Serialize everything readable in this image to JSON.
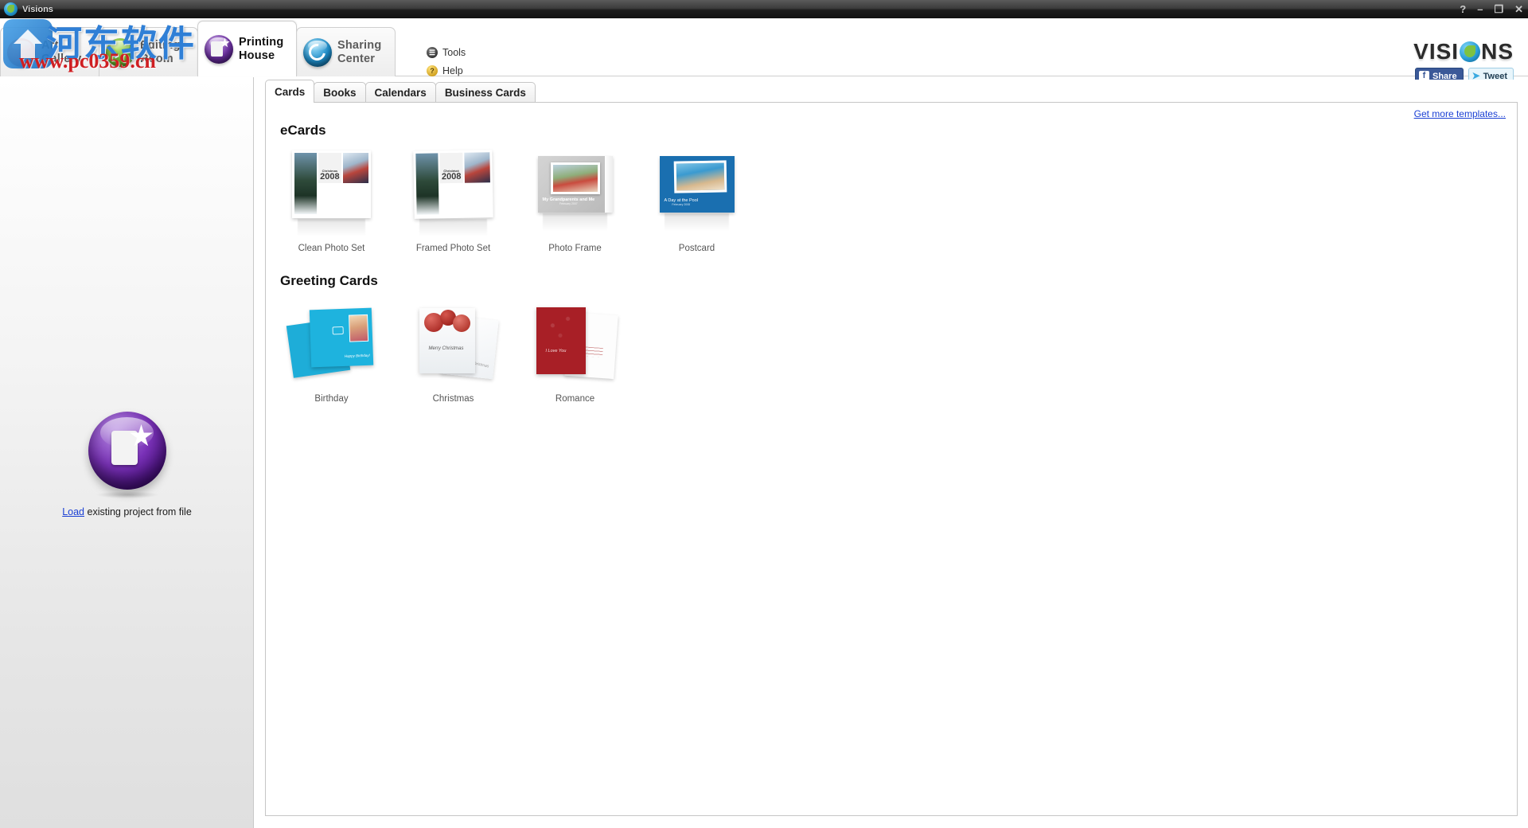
{
  "window": {
    "title": "Visions",
    "app_icon": "visions-swirl-icon",
    "controls": [
      {
        "name": "help",
        "glyph": "?"
      },
      {
        "name": "minimize",
        "glyph": "–"
      },
      {
        "name": "restore",
        "glyph": "❐"
      },
      {
        "name": "close",
        "glyph": "✕"
      }
    ]
  },
  "header": {
    "nav_tabs": [
      {
        "label": "Art\nGallery",
        "orb": "orb-art",
        "active": false
      },
      {
        "label": "Editing\nRoom",
        "orb": "orb-edit",
        "active": false
      },
      {
        "label": "Printing\nHouse",
        "orb": "orb-print",
        "active": true
      },
      {
        "label": "Sharing\nCenter",
        "orb": "orb-share",
        "active": false
      }
    ],
    "menu": [
      {
        "label": "Tools",
        "icon": "tools-icon",
        "glyph": "☰"
      },
      {
        "label": "Help",
        "icon": "help-icon",
        "glyph": "?"
      }
    ],
    "brand": {
      "part1": "VISI",
      "part2": "NS",
      "facebook_label": "Share",
      "facebook_glyph": "f",
      "twitter_label": "Tweet",
      "twitter_glyph": "➤"
    }
  },
  "watermark": {
    "chinese": "河东软件园",
    "url": "www.pc0359.cn"
  },
  "sidebar": {
    "load_link": "Load",
    "load_text": " existing project from file"
  },
  "content": {
    "tabs": [
      {
        "label": "Cards",
        "active": true
      },
      {
        "label": "Books",
        "active": false
      },
      {
        "label": "Calendars",
        "active": false
      },
      {
        "label": "Business Cards",
        "active": false
      }
    ],
    "more_templates_link": "Get more templates...",
    "sections": [
      {
        "title": "eCards",
        "items": [
          {
            "label": "Clean Photo Set",
            "thumb": "collage-clean",
            "year": "2008",
            "occasion": "Christmas"
          },
          {
            "label": "Framed Photo Set",
            "thumb": "collage-framed",
            "year": "2008",
            "occasion": "Christmas"
          },
          {
            "label": "Photo Frame",
            "thumb": "photo-frame",
            "caption": "My Grandparents and Me",
            "subcaption": "February 2007"
          },
          {
            "label": "Postcard",
            "thumb": "postcard",
            "caption": "A Day at the Pool",
            "subcaption": "February 2008"
          }
        ]
      },
      {
        "title": "Greeting Cards",
        "items": [
          {
            "label": "Birthday",
            "thumb": "birthday-card",
            "caption": "Happy Birthday!"
          },
          {
            "label": "Christmas",
            "thumb": "christmas-card",
            "caption": "Merry Christmas"
          },
          {
            "label": "Romance",
            "thumb": "romance-card",
            "caption": "I Love You"
          }
        ]
      }
    ]
  },
  "colors": {
    "accent_purple": "#6b2fa0",
    "link_blue": "#1a3fd4",
    "postcard_blue": "#1a6fb0",
    "birthday_cyan": "#1eb3de",
    "romance_red": "#a81f26"
  }
}
